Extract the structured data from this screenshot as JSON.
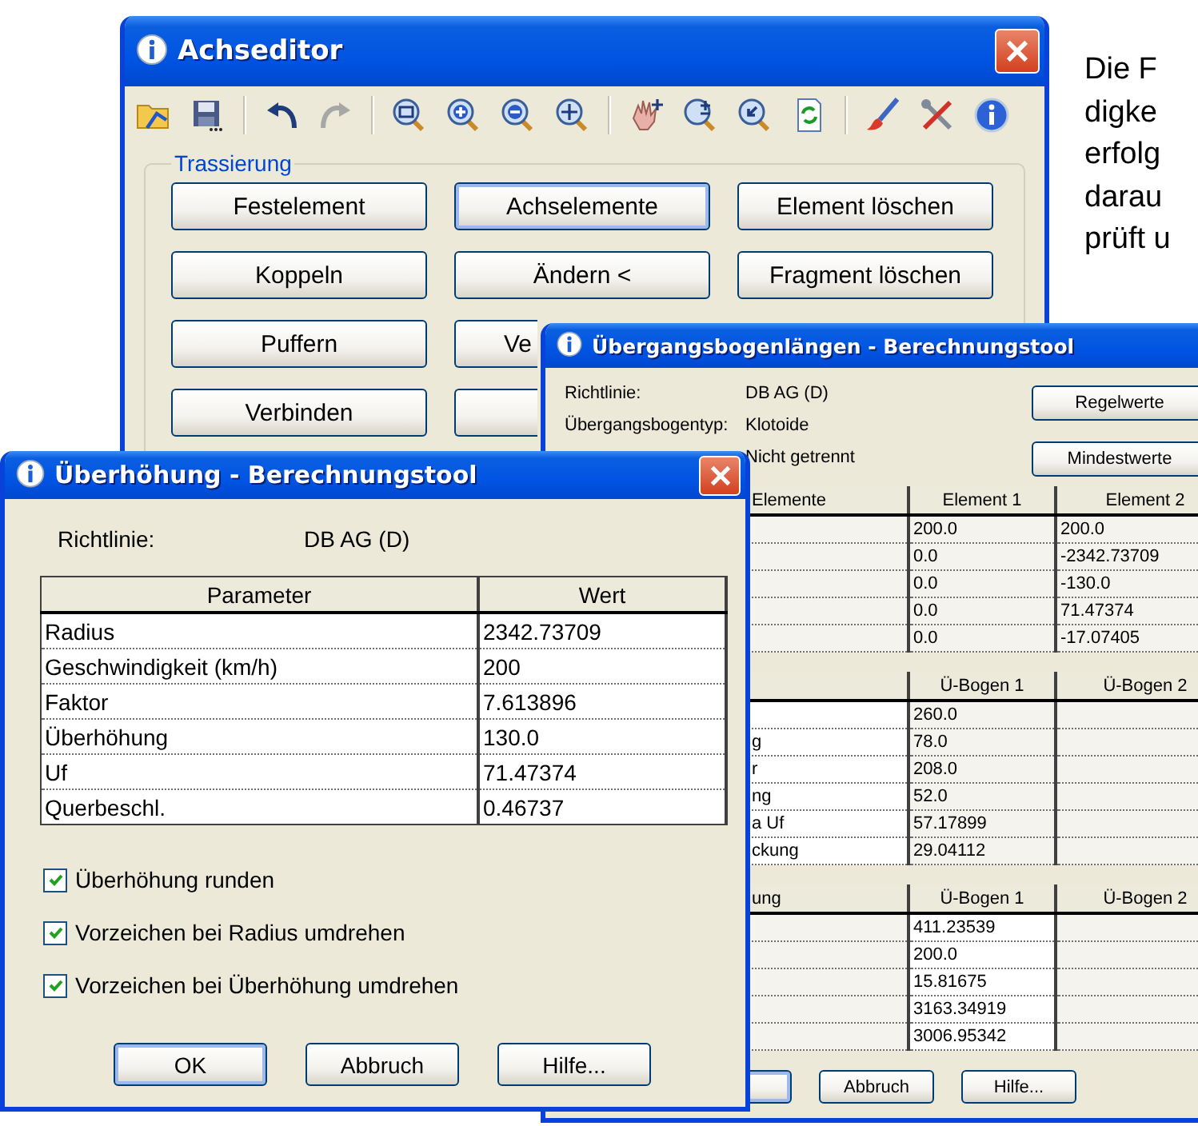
{
  "background_text": {
    "lines": [
      "Die F",
      "digke",
      "erfolg",
      "darau",
      "prüft u"
    ]
  },
  "axis_editor_window": {
    "title": "Achseditor",
    "toolbar": [
      {
        "kind": "folder",
        "disabled": false
      },
      {
        "kind": "save",
        "disabled": false
      },
      {
        "kind": "separator"
      },
      {
        "kind": "undo",
        "disabled": false
      },
      {
        "kind": "redo",
        "disabled": true
      },
      {
        "kind": "separator"
      },
      {
        "kind": "zoom-box",
        "disabled": false
      },
      {
        "kind": "zoom-in",
        "disabled": false
      },
      {
        "kind": "zoom-out",
        "disabled": false
      },
      {
        "kind": "zoom-move",
        "disabled": false
      },
      {
        "kind": "separator"
      },
      {
        "kind": "hand",
        "disabled": false
      },
      {
        "kind": "zoom-plus-minus",
        "disabled": false
      },
      {
        "kind": "zoom-back",
        "disabled": false
      },
      {
        "kind": "refresh",
        "disabled": false
      },
      {
        "kind": "separator"
      },
      {
        "kind": "brush",
        "disabled": false
      },
      {
        "kind": "tools",
        "disabled": false
      },
      {
        "kind": "info",
        "disabled": false
      }
    ],
    "group_label": "Trassierung",
    "button_rows": [
      [
        {
          "label": "Festelement",
          "focused": false,
          "clipped": false
        },
        {
          "label": "Achselemente",
          "focused": true,
          "clipped": false
        },
        {
          "label": "Element löschen",
          "focused": false,
          "clipped": false
        }
      ],
      [
        {
          "label": "Koppeln",
          "focused": false,
          "clipped": false
        },
        {
          "label": "Ändern <",
          "focused": false,
          "clipped": false
        },
        {
          "label": "Fragment löschen",
          "focused": false,
          "clipped": false
        }
      ],
      [
        {
          "label": "Puffern",
          "focused": false,
          "clipped": false
        },
        {
          "label": "Ve",
          "focused": false,
          "clipped": true
        }
      ],
      [
        {
          "label": "Verbinden",
          "focused": false,
          "clipped": false
        },
        {
          "focused": false,
          "clipped": true
        }
      ]
    ]
  },
  "transition_window": {
    "title": "Übergangsbogenlängen - Berechnungstool",
    "info": [
      {
        "label": "Richtlinie:",
        "value": "DB AG (D)"
      },
      {
        "label": "Übergangsbogentyp:",
        "value": "Klotoide"
      },
      {
        "value": "Nicht getrennt"
      }
    ],
    "side_buttons": [
      "Regelwerte",
      "Mindestwerte"
    ],
    "tables": [
      {
        "columns": [
          {
            "label": "Elemente",
            "editable": false
          },
          {
            "label": "Element 1",
            "editable": false
          },
          {
            "label": "Element 2",
            "editable": false
          }
        ],
        "rows": [
          [
            null,
            "200.0",
            "200.0"
          ],
          [
            null,
            "0.0",
            "-2342.73709"
          ],
          [
            null,
            "0.0",
            "-130.0"
          ],
          [
            null,
            "0.0",
            "71.47374"
          ],
          [
            null,
            "0.0",
            "-17.07405"
          ]
        ]
      },
      {
        "columns": [
          {
            "editable": true
          },
          {
            "label": "Ü-Bogen 1",
            "editable": false
          },
          {
            "label": "Ü-Bogen 2",
            "editable": false
          }
        ],
        "rows": [
          [
            null,
            "260.0",
            null
          ],
          [
            "g",
            "78.0",
            null
          ],
          [
            "r",
            "208.0",
            null
          ],
          [
            "ng",
            "52.0",
            null
          ],
          [
            "a Uf",
            "57.17899",
            null
          ],
          [
            "ckung",
            "29.04112",
            null
          ]
        ]
      },
      {
        "columns": [
          {
            "label": "ung",
            "editable": false
          },
          {
            "label": "Ü-Bogen 1",
            "editable": true
          },
          {
            "label": "Ü-Bogen 2",
            "editable": false
          }
        ],
        "rows": [
          [
            null,
            "411.23539",
            null
          ],
          [
            null,
            "200.0",
            null
          ],
          [
            null,
            "15.81675",
            null
          ],
          [
            null,
            "3163.34919",
            null
          ],
          [
            null,
            "3006.95342",
            null
          ]
        ]
      }
    ],
    "buttons": [
      {
        "focused": true
      },
      {
        "label": "Abbruch",
        "focused": false
      },
      {
        "label": "Hilfe...",
        "focused": false
      }
    ]
  },
  "superelevation_window": {
    "title": "Überhöhung - Berechnungstool",
    "info": {
      "label": "Richtlinie:",
      "value": "DB AG (D)"
    },
    "columns": [
      "Parameter",
      "Wert"
    ],
    "rows": [
      [
        "Radius",
        "2342.73709"
      ],
      [
        "Geschwindigkeit (km/h)",
        "200"
      ],
      [
        "Faktor",
        "7.613896"
      ],
      [
        "Überhöhung",
        "130.0"
      ],
      [
        "Uf",
        "71.47374"
      ],
      [
        "Querbeschl.",
        "0.46737"
      ]
    ],
    "checkboxes": [
      {
        "label": "Überhöhung runden",
        "checked": true
      },
      {
        "label": "Vorzeichen bei Radius umdrehen",
        "checked": true
      },
      {
        "label": "Vorzeichen bei Überhöhung umdrehen",
        "checked": true
      }
    ],
    "buttons": [
      {
        "label": "OK",
        "focused": true
      },
      {
        "label": "Abbruch",
        "focused": false
      },
      {
        "label": "Hilfe...",
        "focused": false
      }
    ]
  }
}
